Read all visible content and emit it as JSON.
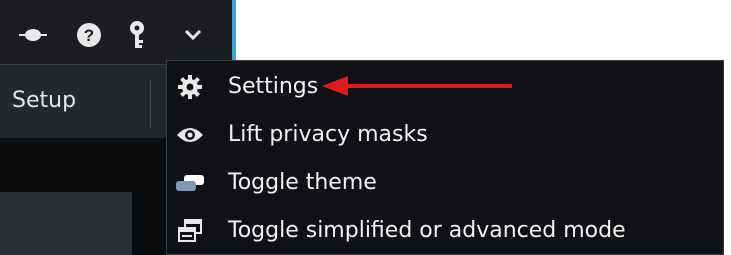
{
  "toolbar": {
    "icons": [
      "plug-icon",
      "help-icon",
      "key-icon",
      "chevron-down-icon"
    ],
    "setup_label": "Setup"
  },
  "menu": {
    "items": [
      {
        "label": "Settings",
        "icon": "gear-icon"
      },
      {
        "label": "Lift privacy masks",
        "icon": "eye-icon"
      },
      {
        "label": "Toggle theme",
        "icon": "theme-icon"
      },
      {
        "label": "Toggle simplified or advanced mode",
        "icon": "mode-icon"
      }
    ]
  },
  "colors": {
    "app_background": "#1b1d21",
    "menu_background": "#101114",
    "accent": "#3aa6d8",
    "annotation_arrow": "#e01b1b",
    "menu_text": "#f2f2f2"
  }
}
